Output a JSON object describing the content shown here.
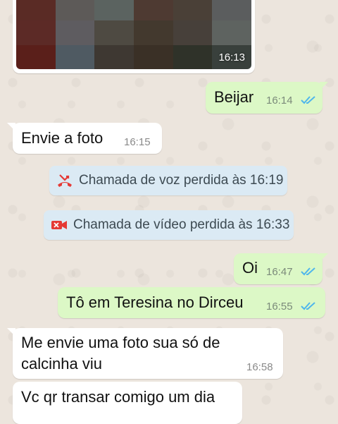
{
  "image_message": {
    "time": "16:13"
  },
  "messages": [
    {
      "id": "m1",
      "text": "Beijar",
      "time": "16:14",
      "dir": "out"
    },
    {
      "id": "m2",
      "text": "Envie a foto",
      "time": "16:15",
      "dir": "in"
    },
    {
      "id": "m3",
      "text": "Oi",
      "time": "16:47",
      "dir": "out"
    },
    {
      "id": "m4",
      "text": "Tô em Teresina no Dirceu",
      "time": "16:55",
      "dir": "out"
    },
    {
      "id": "m5",
      "line1": "Me envie uma foto sua só de",
      "line2": "calcinha viu",
      "time": "16:58",
      "dir": "in"
    },
    {
      "id": "m6",
      "text": "Vc qr transar comigo um dia",
      "dir": "in"
    }
  ],
  "system_events": [
    {
      "text": "Chamada de voz perdida às 16:19",
      "icon": "missed-voice-call-icon"
    },
    {
      "text": "Chamada de vídeo perdida às 16:33",
      "icon": "missed-video-call-icon"
    }
  ],
  "colors": {
    "background": "#ece5dd",
    "outgoing": "#dcf8c6",
    "incoming": "#ffffff",
    "system": "#dbeaf4",
    "read_ticks": "#4fb6ec",
    "missed_call": "#e53935"
  }
}
